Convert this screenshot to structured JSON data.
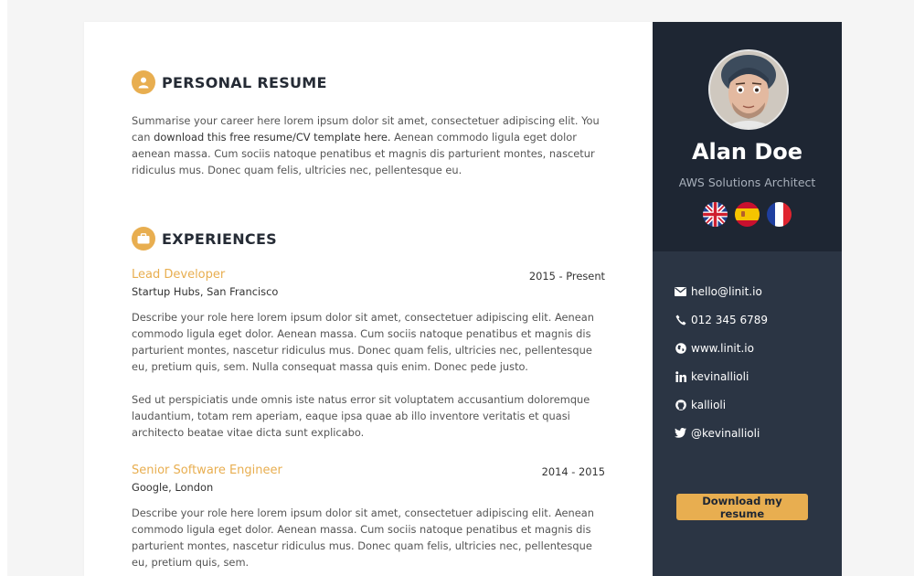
{
  "resume": {
    "personal": {
      "heading": "PERSONAL RESUME",
      "summary_a": "Summarise your career here lorem ipsum dolor sit amet, consectetuer adipiscing elit. You can",
      "summary_b": "download this free resume/CV template here.",
      "summary_c": " Aenean commodo ligula eget dolor aenean massa. Cum sociis natoque penatibus et magnis dis parturient montes, nascetur ridiculus mus. Donec quam felis, ultricies nec, pellentesque eu."
    },
    "experiences": {
      "heading": "EXPERIENCES",
      "jobs": [
        {
          "title": "Lead Developer",
          "date": "2015 - Present",
          "company": "Startup Hubs, San Francisco",
          "desc1": "Describe your role here lorem ipsum dolor sit amet, consectetuer adipiscing elit. Aenean commodo ligula eget dolor. Aenean massa. Cum sociis natoque penatibus et magnis dis parturient montes, nascetur ridiculus mus. Donec quam felis, ultricies nec, pellentesque eu, pretium quis, sem. Nulla consequat massa quis enim. Donec pede justo.",
          "desc2": "Sed ut perspiciatis unde omnis iste natus error sit voluptatem accusantium doloremque laudantium, totam rem aperiam, eaque ipsa quae ab illo inventore veritatis et quasi architecto beatae vitae dicta sunt explicabo."
        },
        {
          "title": "Senior Software Engineer",
          "date": "2014 - 2015",
          "company": "Google, London",
          "desc1": "Describe your role here lorem ipsum dolor sit amet, consectetuer adipiscing elit. Aenean commodo ligula eget dolor. Aenean massa. Cum sociis natoque penatibus et magnis dis parturient montes, nascetur ridiculus mus. Donec quam felis, ultricies nec, pellentesque eu, pretium quis, sem."
        }
      ]
    }
  },
  "sidebar": {
    "name": "Alan Doe",
    "role": "AWS Solutions Architect",
    "flags": [
      "uk-flag-icon",
      "spain-flag-icon",
      "france-flag-icon"
    ],
    "contacts": [
      {
        "icon": "envelope-icon",
        "label": "hello@linit.io"
      },
      {
        "icon": "phone-icon",
        "label": "012 345 6789"
      },
      {
        "icon": "globe-icon",
        "label": "www.linit.io"
      },
      {
        "icon": "linkedin-icon",
        "label": "kevinallioli"
      },
      {
        "icon": "github-icon",
        "label": "kallioli"
      },
      {
        "icon": "twitter-icon",
        "label": "@kevinallioli"
      }
    ],
    "download_label": "Download my resume"
  },
  "colors": {
    "accent": "#e8ae50",
    "sidebar_dark": "#1e2633",
    "sidebar": "#2b3544"
  }
}
